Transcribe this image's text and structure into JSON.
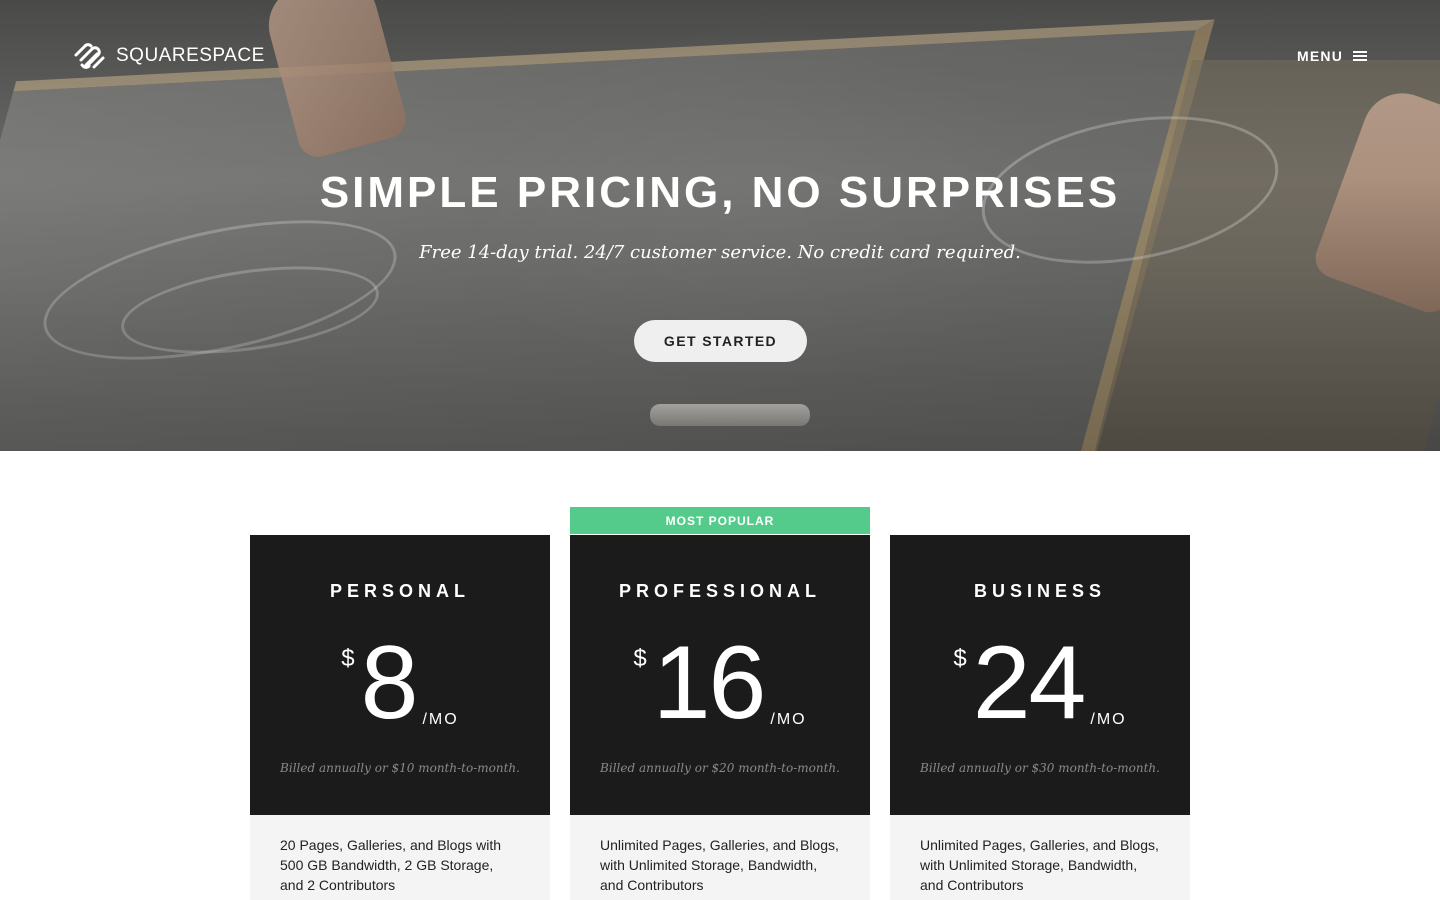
{
  "header": {
    "logo_text": "SQUARESPACE",
    "menu_label": "MENU"
  },
  "hero": {
    "title": "SIMPLE PRICING, NO SURPRISES",
    "subtitle": "Free 14-day trial. 24/7 customer service. No credit card required.",
    "cta_label": "GET STARTED"
  },
  "pricing": {
    "badge": "MOST POPULAR",
    "badge_color": "#54cb8a",
    "plans": [
      {
        "name": "PERSONAL",
        "currency": "$",
        "amount": "8",
        "per": "/MO",
        "billing": "Billed annually or $10 month-to-month.",
        "description": "20 Pages, Galleries, and Blogs with 500 GB Bandwidth, 2 GB Storage, and 2 Contributors"
      },
      {
        "name": "PROFESSIONAL",
        "currency": "$",
        "amount": "16",
        "per": "/MO",
        "billing": "Billed annually or $20 month-to-month.",
        "description": "Unlimited Pages, Galleries, and Blogs, with Unlimited Storage, Bandwidth, and Contributors"
      },
      {
        "name": "BUSINESS",
        "currency": "$",
        "amount": "24",
        "per": "/MO",
        "billing": "Billed annually or $30 month-to-month.",
        "description": "Unlimited Pages, Galleries, and Blogs, with Unlimited Storage, Bandwidth, and Contributors"
      }
    ]
  }
}
